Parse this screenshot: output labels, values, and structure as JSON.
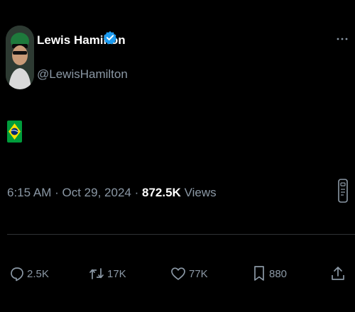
{
  "user": {
    "display_name": "Lewis Hamilton",
    "handle": "@LewisHamilton",
    "verified": true
  },
  "tweet": {
    "text_icon": "brazil-flag-emoji",
    "time": "6:15 AM",
    "separator1": "·",
    "date": "Oct 29, 2024",
    "separator2": "·",
    "views_count": "872.5K",
    "views_label": "Views"
  },
  "actions": {
    "replies": "2.5K",
    "reposts": "17K",
    "likes": "77K",
    "bookmarks": "880"
  },
  "colors": {
    "background": "#000000",
    "primary_text": "#ffffff",
    "secondary_text": "#8b98a5",
    "verified_badge": "#1d9bf0",
    "divider": "#2f3336"
  },
  "icons": {
    "verified": "verified-badge-icon",
    "more": "more-options-icon",
    "analytics": "analytics-icon",
    "reply": "reply-icon",
    "repost": "repost-icon",
    "like": "heart-icon",
    "bookmark": "bookmark-icon",
    "share": "share-icon"
  }
}
